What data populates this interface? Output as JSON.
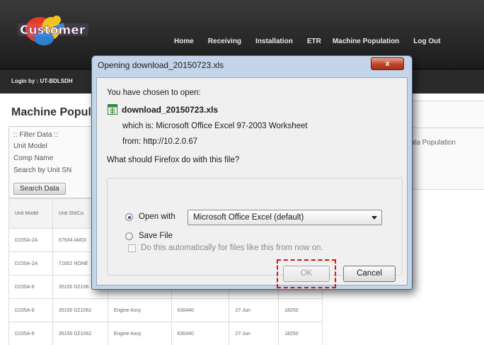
{
  "app": {
    "logo_text": "Customer",
    "nav": [
      "Home",
      "Receiving",
      "Installation",
      "ETR",
      "Machine Population",
      "Log Out"
    ],
    "login_text": "Login by : UT-BDLSDH"
  },
  "page": {
    "title": "Machine Popul",
    "filter": {
      "header": ":: Filter Data ::",
      "fields": [
        "Unit Model",
        "Comp Name",
        "Search by Unit SN"
      ],
      "search_button": "Search Data"
    },
    "right_panel_text": "ata Population",
    "table": {
      "headers": [
        "Unit Model",
        "Unit SN/Co",
        "",
        "",
        "",
        ""
      ],
      "rows": [
        [
          "D155A-2A",
          "57934 AMOI",
          "",
          "",
          "",
          ""
        ],
        [
          "D155A-2A",
          "71852 NONE",
          "",
          "",
          "",
          ""
        ],
        [
          "D155A-6",
          "35150 DZ106",
          "",
          "",
          "",
          ""
        ],
        [
          "D155A-6",
          "35150 DZ1062",
          "Engine Assy",
          "630440",
          "27-Jun",
          "18250"
        ],
        [
          "D155A-6",
          "35150 DZ1062",
          "Engine Assy",
          "630440",
          "27-Jun",
          "18250"
        ]
      ]
    }
  },
  "dialog": {
    "title": "Opening download_20150723.xls",
    "close_label": "x",
    "intro": "You have chosen to open:",
    "filename": "download_20150723.xls",
    "which_is": "which is:  Microsoft Office Excel 97-2003 Worksheet",
    "from": "from:  http://10.2.0.67",
    "question": "What should Firefox do with this file?",
    "open_with_label": "Open with",
    "open_with_value": "Microsoft Office Excel (default)",
    "save_file_label": "Save File",
    "auto_label": "Do this automatically for files like this from now on.",
    "ok_label": "OK",
    "cancel_label": "Cancel",
    "selected_option": "open_with",
    "auto_checked": false
  },
  "colors": {
    "header_bg": "#2a2a2a",
    "dialog_frame": "#c4d5ea",
    "close_button": "#c0432b",
    "highlight": "#e01010"
  }
}
